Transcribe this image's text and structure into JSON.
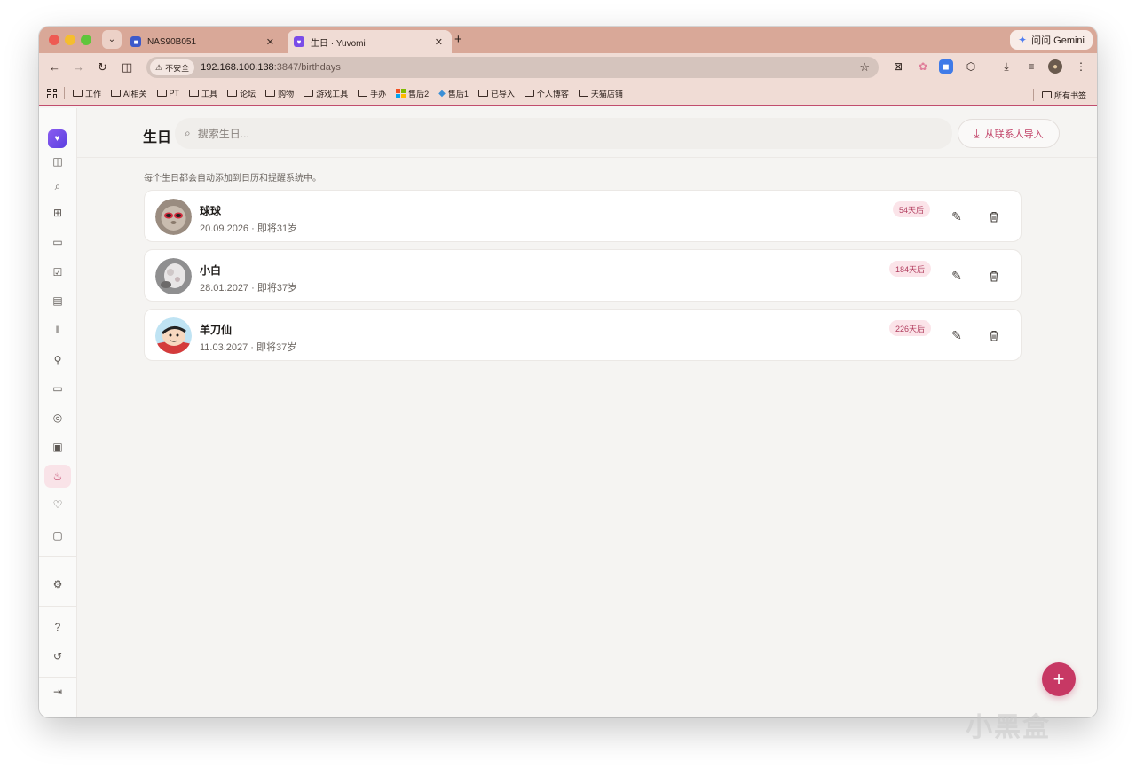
{
  "browser": {
    "tabs": [
      {
        "title": "NAS90B051",
        "favicon": "nas-icon"
      },
      {
        "title": "生日 · Yuvomi",
        "favicon": "yuvomi-icon"
      }
    ],
    "gemini_label": "问问 Gemini",
    "security_label": "不安全",
    "url_host": "192.168.100.138",
    "url_rest": ":3847/birthdays",
    "bookmarks": [
      "工作",
      "AI相关",
      "PT",
      "工具",
      "论坛",
      "购物",
      "游戏工具",
      "手办",
      "售后2",
      "售后1",
      "已导入",
      "个人博客",
      "天猫店铺"
    ],
    "all_bookmarks_label": "所有书签"
  },
  "header": {
    "title": "生日",
    "search_placeholder": "搜索生日...",
    "import_label": "从联系人导入"
  },
  "hint": "每个生日都会自动添加到日历和提醒系统中。",
  "birthdays": [
    {
      "name": "球球",
      "date": "20.09.2026",
      "age_text": "即将31岁",
      "countdown": "54天后"
    },
    {
      "name": "小白",
      "date": "28.01.2027",
      "age_text": "即将37岁",
      "countdown": "184天后"
    },
    {
      "name": "羊刀仙",
      "date": "11.03.2027",
      "age_text": "即将37岁",
      "countdown": "226天后"
    }
  ],
  "sidebar_icons": [
    "panel-icon",
    "search-icon",
    "grid-icon",
    "calendar-icon",
    "check-icon",
    "note-icon",
    "fork-knife-icon",
    "tool-icon",
    "folder-icon",
    "award-icon",
    "id-card-icon",
    "cake-icon",
    "heart-pulse-icon",
    "wallet-icon",
    "settings-icon",
    "help-icon",
    "history-icon",
    "logout-icon"
  ],
  "watermark": "小黑盒",
  "colors": {
    "accent": "#c73864",
    "badge_bg": "#fbe4e9",
    "tab_strip": "#d9a898"
  }
}
